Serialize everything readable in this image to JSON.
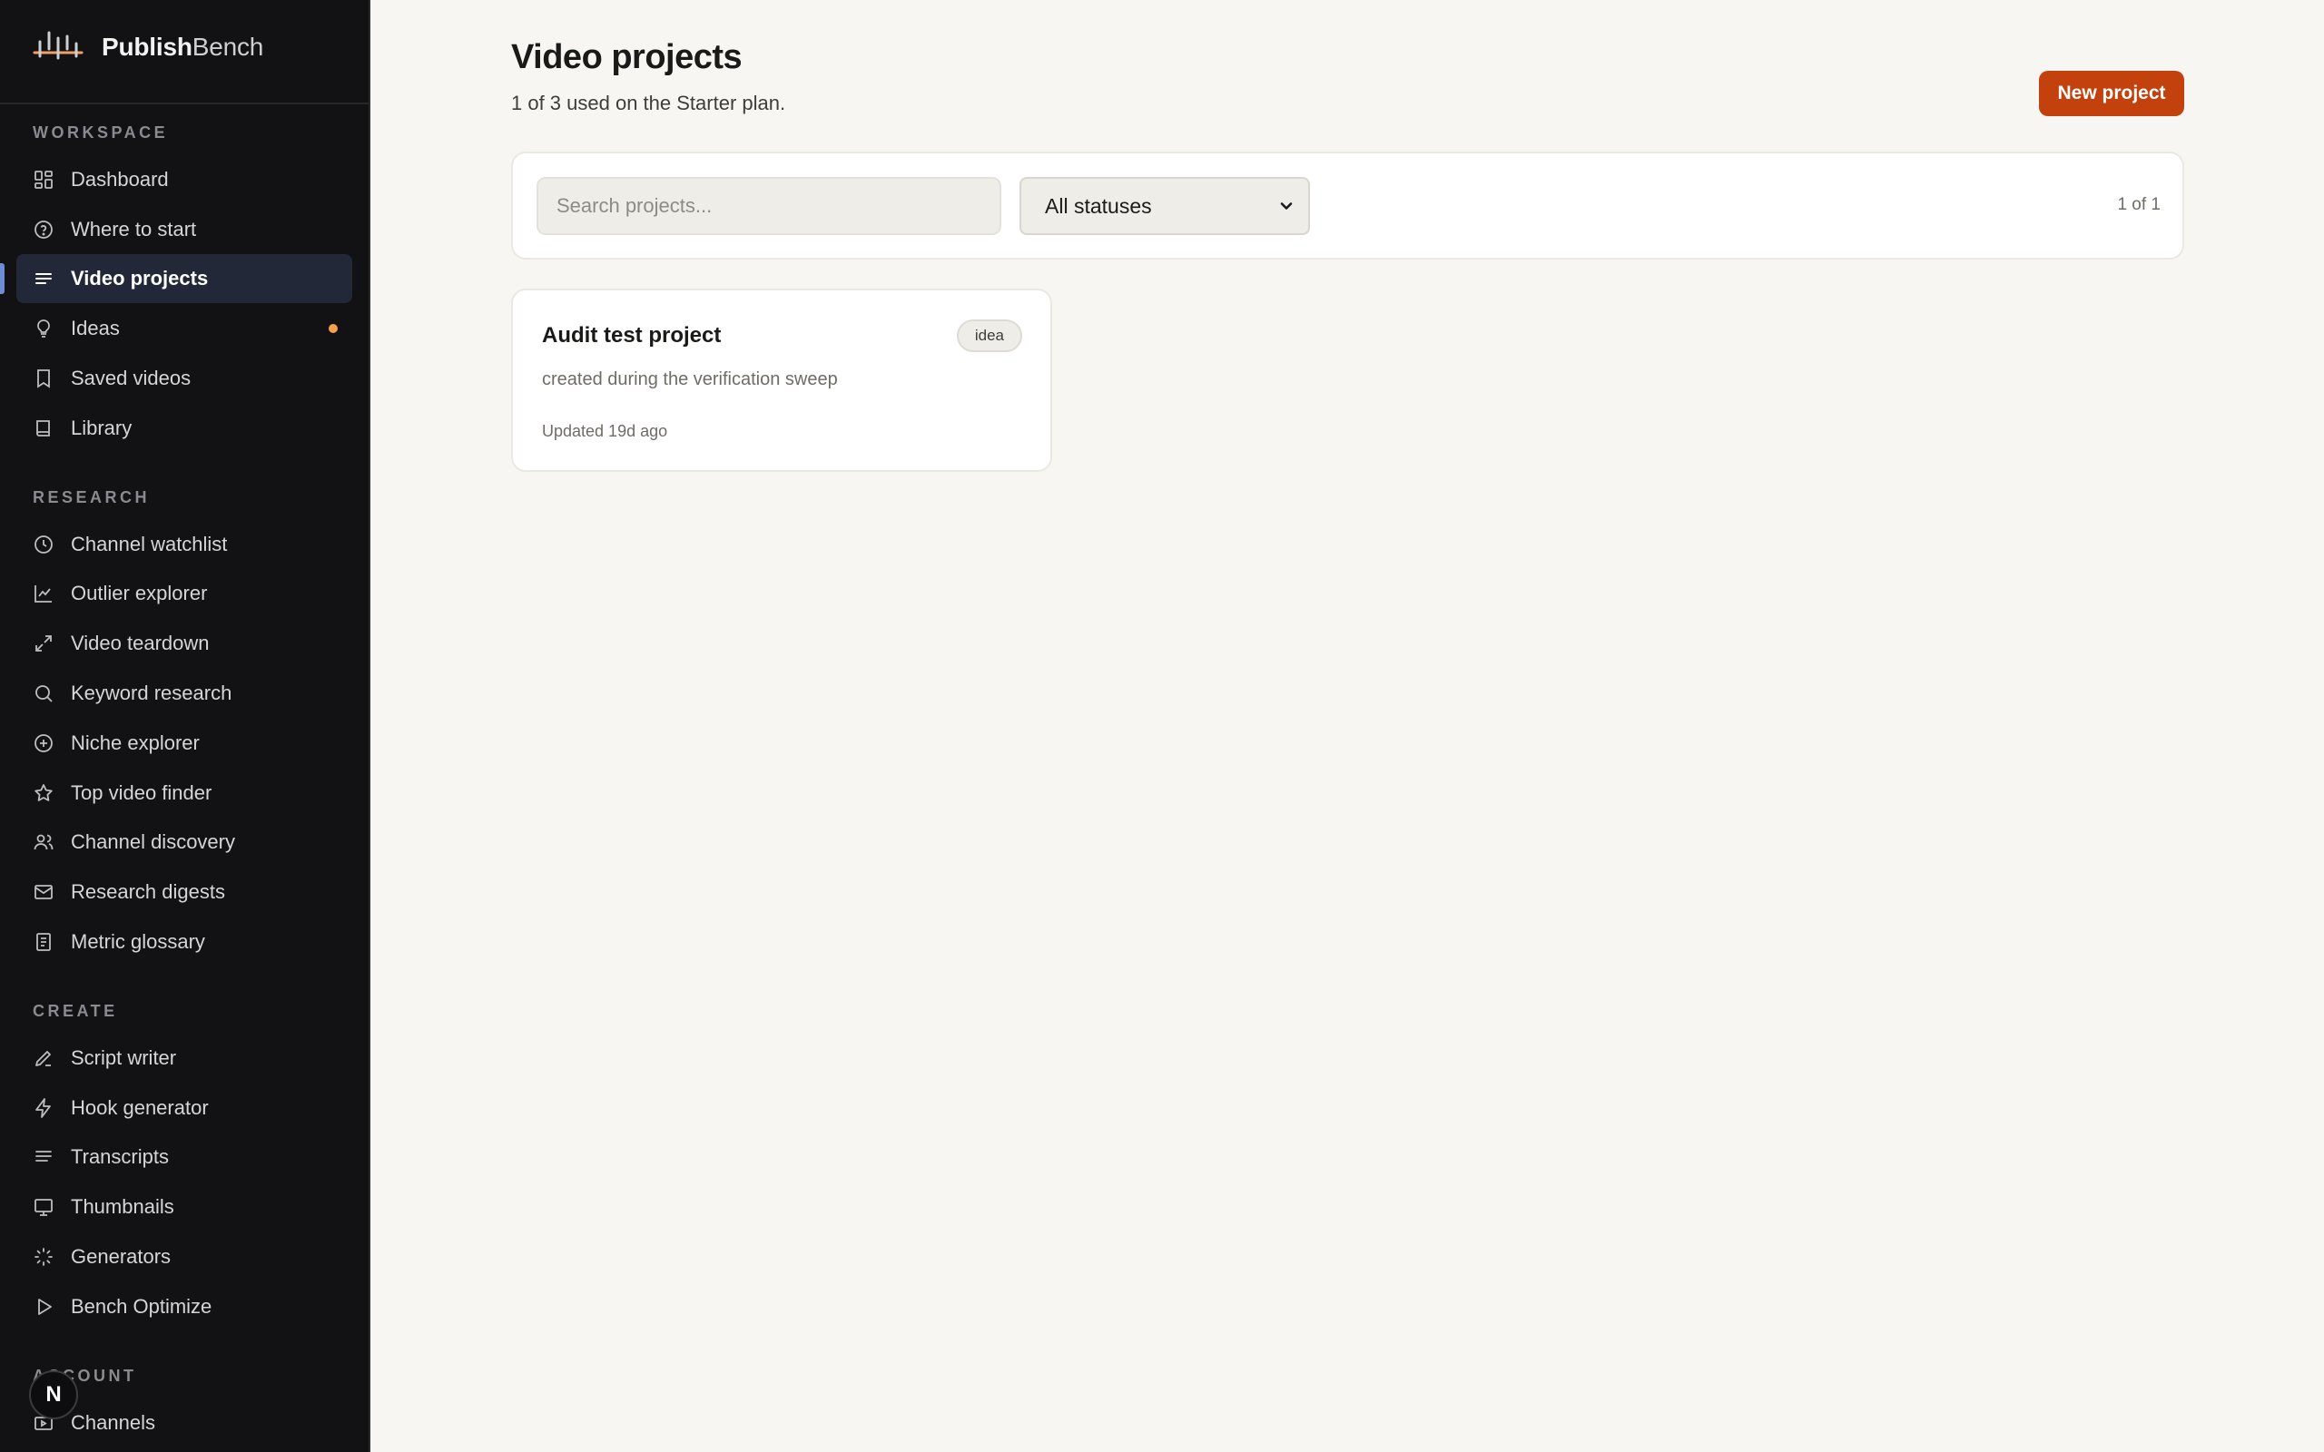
{
  "brand": {
    "name_bold": "Publish",
    "name_light": "Bench"
  },
  "sidebar": {
    "sections": [
      {
        "label": "WORKSPACE",
        "items": [
          {
            "label": "Dashboard",
            "icon": "dashboard-icon"
          },
          {
            "label": "Where to start",
            "icon": "help-circle-icon"
          },
          {
            "label": "Video projects",
            "icon": "list-icon",
            "active": true
          },
          {
            "label": "Ideas",
            "icon": "lightbulb-icon",
            "notification": true
          },
          {
            "label": "Saved videos",
            "icon": "bookmark-icon"
          },
          {
            "label": "Library",
            "icon": "book-icon"
          }
        ]
      },
      {
        "label": "RESEARCH",
        "items": [
          {
            "label": "Channel watchlist",
            "icon": "clock-icon"
          },
          {
            "label": "Outlier explorer",
            "icon": "line-chart-icon"
          },
          {
            "label": "Video teardown",
            "icon": "expand-icon"
          },
          {
            "label": "Keyword research",
            "icon": "search-icon"
          },
          {
            "label": "Niche explorer",
            "icon": "plus-circle-icon"
          },
          {
            "label": "Top video finder",
            "icon": "star-icon"
          },
          {
            "label": "Channel discovery",
            "icon": "users-icon"
          },
          {
            "label": "Research digests",
            "icon": "mail-icon"
          },
          {
            "label": "Metric glossary",
            "icon": "glossary-icon"
          }
        ]
      },
      {
        "label": "CREATE",
        "items": [
          {
            "label": "Script writer",
            "icon": "pencil-icon"
          },
          {
            "label": "Hook generator",
            "icon": "lightning-icon"
          },
          {
            "label": "Transcripts",
            "icon": "text-lines-icon"
          },
          {
            "label": "Thumbnails",
            "icon": "monitor-icon"
          },
          {
            "label": "Generators",
            "icon": "loader-icon"
          },
          {
            "label": "Bench Optimize",
            "icon": "play-icon"
          }
        ]
      },
      {
        "label": "ACCOUNT",
        "items": [
          {
            "label": "Channels",
            "icon": "channels-icon"
          }
        ]
      }
    ],
    "avatar_initial": "N"
  },
  "main": {
    "title": "Video projects",
    "subtitle": "1 of 3 used on the Starter plan.",
    "new_button": "New project",
    "search_placeholder": "Search projects...",
    "status_filter": "All statuses",
    "count": "1 of 1",
    "projects": [
      {
        "title": "Audit test project",
        "status": "idea",
        "description": "created during the verification sweep",
        "updated": "Updated 19d ago"
      }
    ]
  },
  "colors": {
    "accent": "#c2410c",
    "sidebar_bg": "#121214",
    "active_bg": "#232838",
    "active_bar": "#6d8bd6",
    "notification": "#f4a14a"
  }
}
